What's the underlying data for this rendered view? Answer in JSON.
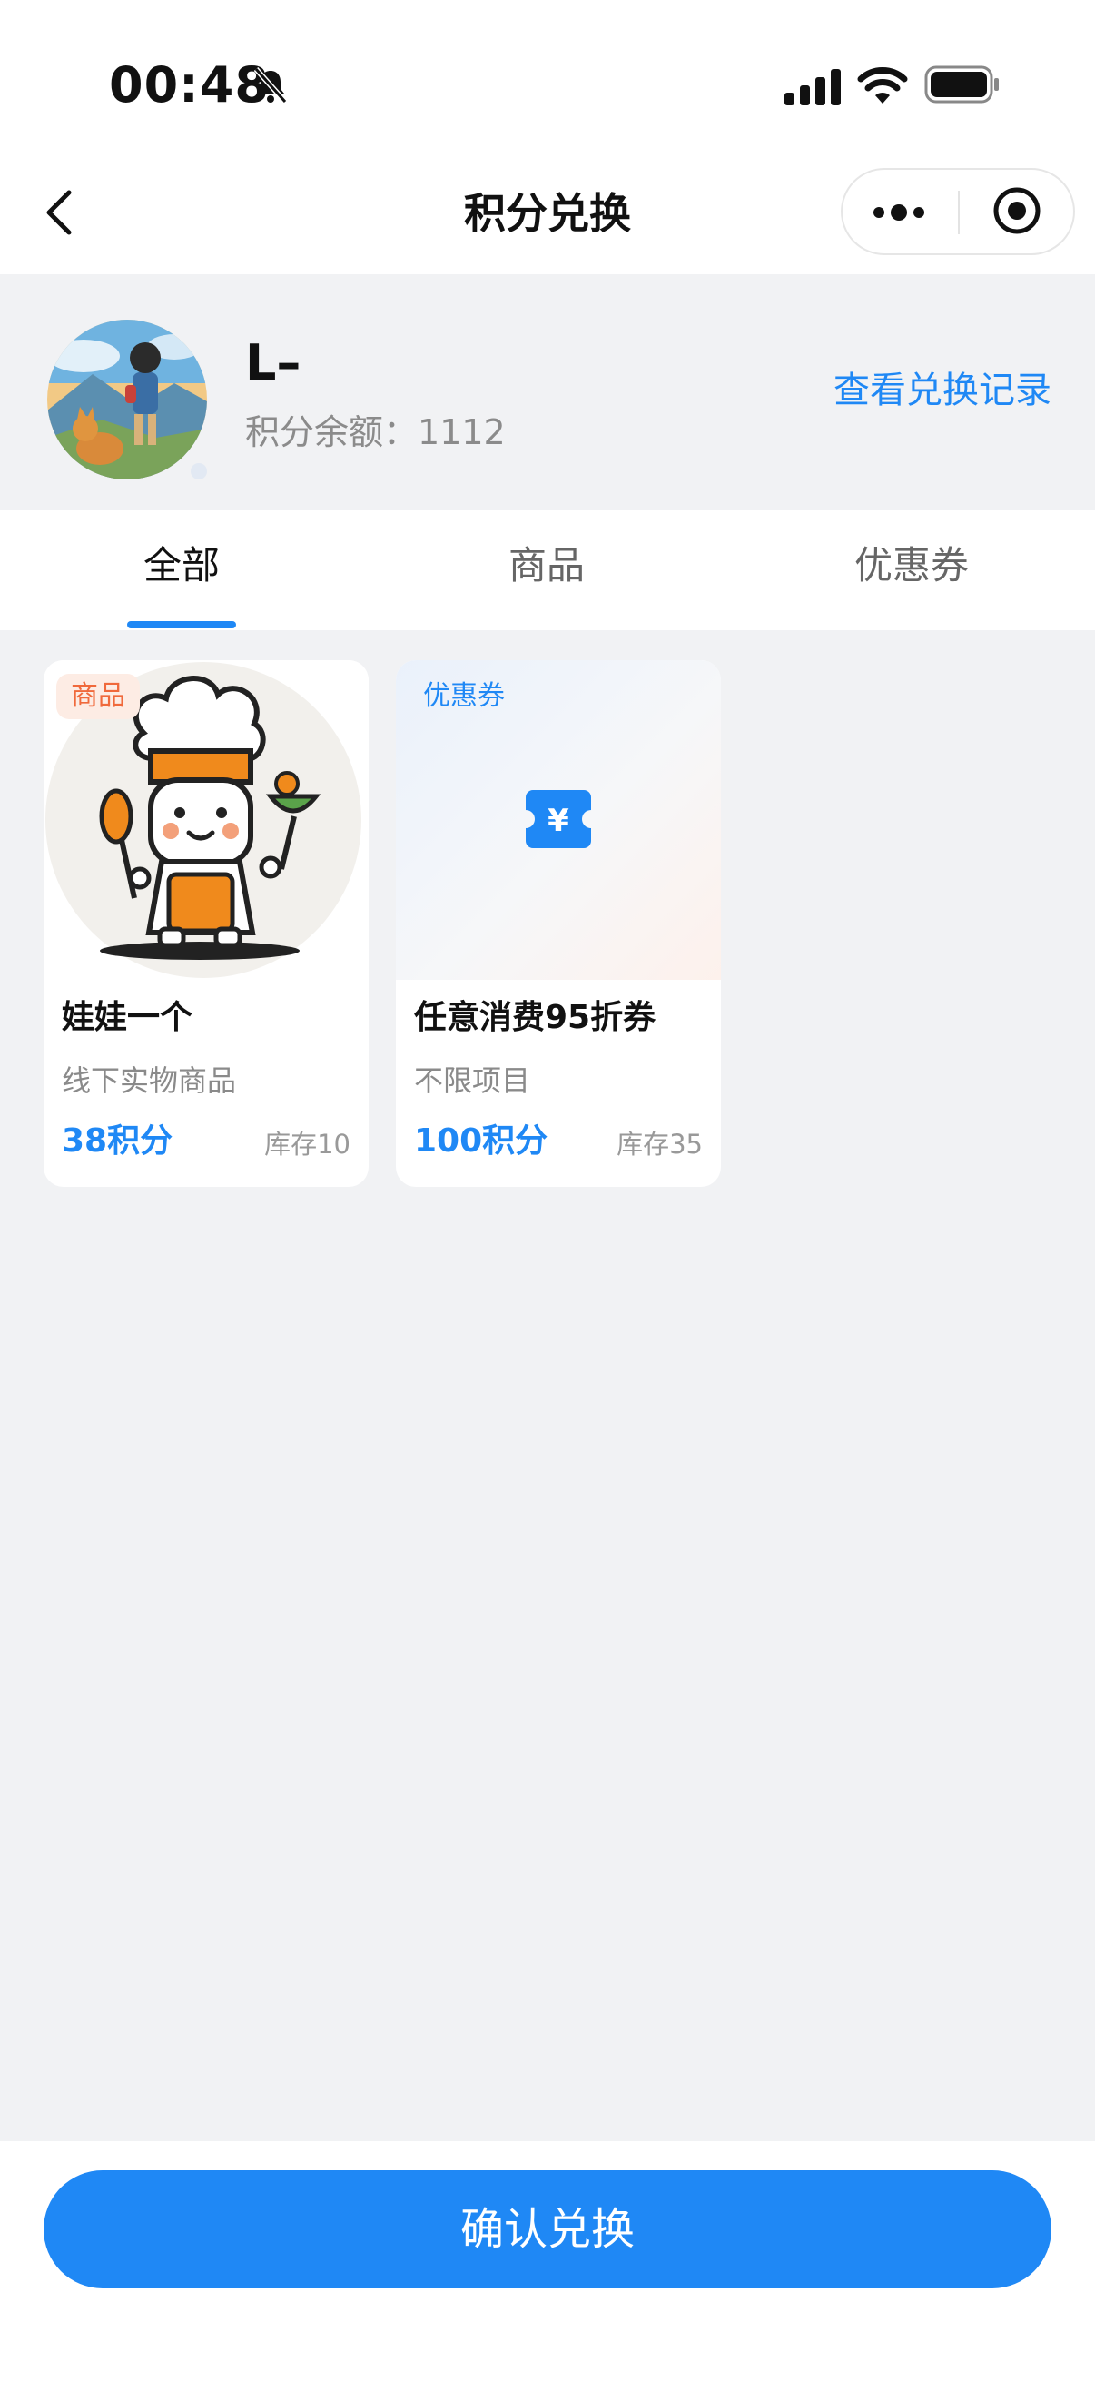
{
  "status_bar": {
    "time": "00:48"
  },
  "nav": {
    "title": "积分兑换"
  },
  "profile": {
    "username": "L–",
    "points_label": "积分余额：",
    "points_value": "1112",
    "history_link": "查看兑换记录"
  },
  "tabs": [
    {
      "label": "全部",
      "active": true
    },
    {
      "label": "商品",
      "active": false
    },
    {
      "label": "优惠券",
      "active": false
    }
  ],
  "items": [
    {
      "badge": "商品",
      "name": "娃娃一个",
      "subtitle": "线下实物商品",
      "price": "38积分",
      "stock": "库存10"
    },
    {
      "badge": "优惠券",
      "name": "任意消费95折券",
      "subtitle": "不限项目",
      "price": "100积分",
      "stock": "库存35"
    }
  ],
  "confirm_button": "确认兑换",
  "colors": {
    "accent": "#1f88f5",
    "goods_badge": "#f0693b",
    "background": "#f1f2f4"
  }
}
